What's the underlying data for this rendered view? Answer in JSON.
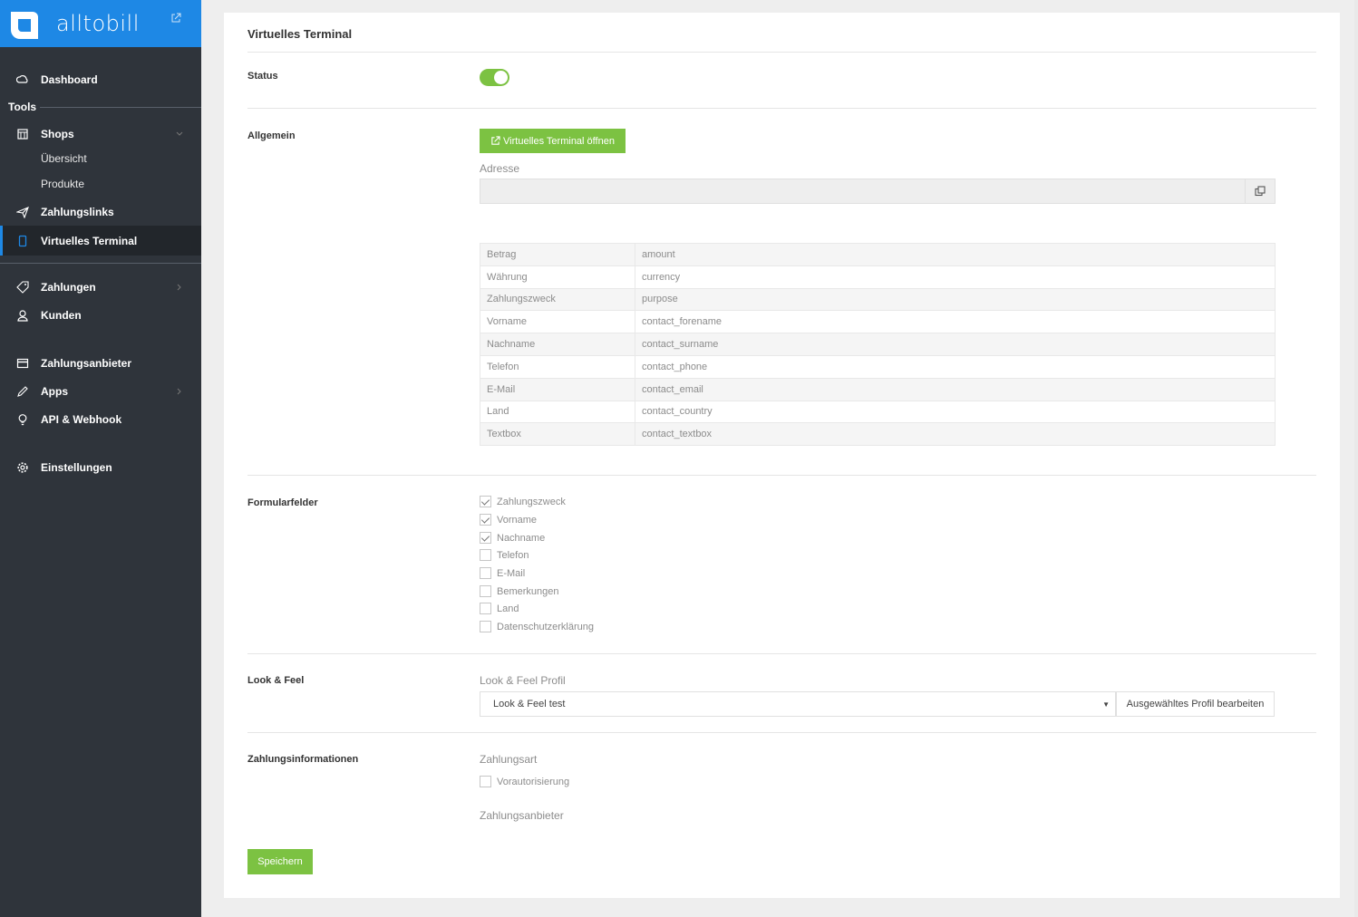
{
  "brand": {
    "name": "alltobill",
    "color": "#1e88e5"
  },
  "sidebar": {
    "dashboard": "Dashboard",
    "tools_heading": "Tools",
    "shops": "Shops",
    "shops_sub": [
      "Übersicht",
      "Produkte"
    ],
    "zahlungslinks": "Zahlungslinks",
    "virtuelles_terminal": "Virtuelles Terminal",
    "zahlungen": "Zahlungen",
    "kunden": "Kunden",
    "zahlungsanbieter": "Zahlungsanbieter",
    "apps": "Apps",
    "api_webhook": "API & Webhook",
    "einstellungen": "Einstellungen"
  },
  "page": {
    "title": "Virtuelles Terminal",
    "status": {
      "label": "Status",
      "enabled": true
    },
    "allgemein": {
      "label": "Allgemein",
      "open_button": "Virtuelles Terminal öffnen",
      "address_label": "Adresse",
      "address_value": "",
      "mapping": [
        {
          "name": "Betrag",
          "param": "amount"
        },
        {
          "name": "Währung",
          "param": "currency"
        },
        {
          "name": "Zahlungszweck",
          "param": "purpose"
        },
        {
          "name": "Vorname",
          "param": "contact_forename"
        },
        {
          "name": "Nachname",
          "param": "contact_surname"
        },
        {
          "name": "Telefon",
          "param": "contact_phone"
        },
        {
          "name": "E-Mail",
          "param": "contact_email"
        },
        {
          "name": "Land",
          "param": "contact_country"
        },
        {
          "name": "Textbox",
          "param": "contact_textbox"
        }
      ]
    },
    "formularfelder": {
      "label": "Formularfelder",
      "fields": [
        {
          "label": "Zahlungszweck",
          "checked": true
        },
        {
          "label": "Vorname",
          "checked": true
        },
        {
          "label": "Nachname",
          "checked": true
        },
        {
          "label": "Telefon",
          "checked": false
        },
        {
          "label": "E-Mail",
          "checked": false
        },
        {
          "label": "Bemerkungen",
          "checked": false
        },
        {
          "label": "Land",
          "checked": false
        },
        {
          "label": "Datenschutzerklärung",
          "checked": false
        }
      ]
    },
    "look_feel": {
      "label": "Look & Feel",
      "profile_label": "Look & Feel Profil",
      "selected_profile": "Look & Feel test",
      "edit_button": "Ausgewähltes Profil bearbeiten"
    },
    "zahlungsinformationen": {
      "label": "Zahlungsinformationen",
      "zahlungsart_label": "Zahlungsart",
      "vorautorisierung": {
        "label": "Vorautorisierung",
        "checked": false
      },
      "zahlungsanbieter_label": "Zahlungsanbieter"
    },
    "save_button": "Speichern"
  },
  "colors": {
    "accent_green": "#7cc242",
    "sidebar_bg": "#2f343b",
    "active_marker": "#1e88e5"
  }
}
